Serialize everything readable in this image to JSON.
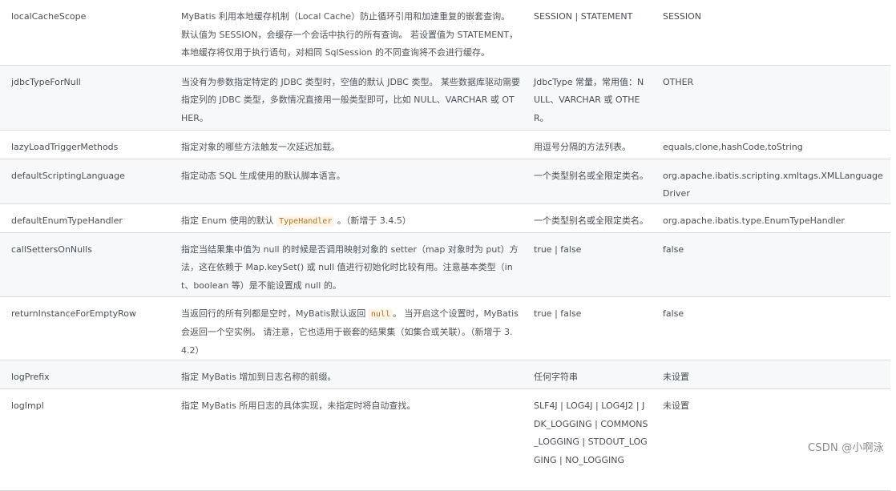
{
  "rows": [
    {
      "name": "localCacheScope",
      "desc": "MyBatis 利用本地缓存机制（Local Cache）防止循环引用和加速重复的嵌套查询。 默认值为 SESSION，会缓存一个会话中执行的所有查询。 若设置值为 STATEMENT，本地缓存将仅用于执行语句，对相同 SqlSession 的不同查询将不会进行缓存。",
      "values": "SESSION | STATEMENT",
      "default": "SESSION"
    },
    {
      "name": "jdbcTypeForNull",
      "desc": "当没有为参数指定特定的 JDBC 类型时，空值的默认 JDBC 类型。 某些数据库驱动需要指定列的 JDBC 类型，多数情况直接用一般类型即可，比如 NULL、VARCHAR 或 OTHER。",
      "values": "JdbcType 常量，常用值：NULL、VARCHAR 或 OTHER。",
      "default": "OTHER"
    },
    {
      "name": "lazyLoadTriggerMethods",
      "desc": "指定对象的哪些方法触发一次延迟加载。",
      "values": "用逗号分隔的方法列表。",
      "default": "equals,clone,hashCode,toString"
    },
    {
      "name": "defaultScriptingLanguage",
      "desc": "指定动态 SQL 生成使用的默认脚本语言。",
      "values": "一个类型别名或全限定类名。",
      "default": "org.apache.ibatis.scripting.xmltags.XMLLanguageDriver"
    },
    {
      "name": "defaultEnumTypeHandler",
      "desc_before": "指定 Enum 使用的默认 ",
      "desc_code": "TypeHandler",
      "desc_after": " 。（新增于 3.4.5）",
      "values": "一个类型别名或全限定类名。",
      "default": "org.apache.ibatis.type.EnumTypeHandler"
    },
    {
      "name": "callSettersOnNulls",
      "desc": "指定当结果集中值为 null 的时候是否调用映射对象的 setter（map 对象时为 put）方法，这在依赖于 Map.keySet() 或 null 值进行初始化时比较有用。注意基本类型（int、boolean 等）是不能设置成 null 的。",
      "values": "true | false",
      "default": "false"
    },
    {
      "name": "returnInstanceForEmptyRow",
      "desc_before": "当返回行的所有列都是空时，MyBatis默认返回 ",
      "desc_code": "null",
      "desc_after": "。 当开启这个设置时，MyBatis会返回一个空实例。 请注意，它也适用于嵌套的结果集（如集合或关联）。（新增于 3.4.2）",
      "values": "true | false",
      "default": "false"
    },
    {
      "name": "logPrefix",
      "desc": "指定 MyBatis 增加到日志名称的前缀。",
      "values": "任何字符串",
      "default": "未设置"
    },
    {
      "name": "logImpl",
      "desc": "指定 MyBatis 所用日志的具体实现，未指定时将自动查找。",
      "values": "SLF4J | LOG4J | LOG4J2 | JDK_LOGGING | COMMONS_LOGGING | STDOUT_LOGGING | NO_LOGGING",
      "default": "未设置"
    }
  ],
  "watermark": "CSDN @小啊泳"
}
